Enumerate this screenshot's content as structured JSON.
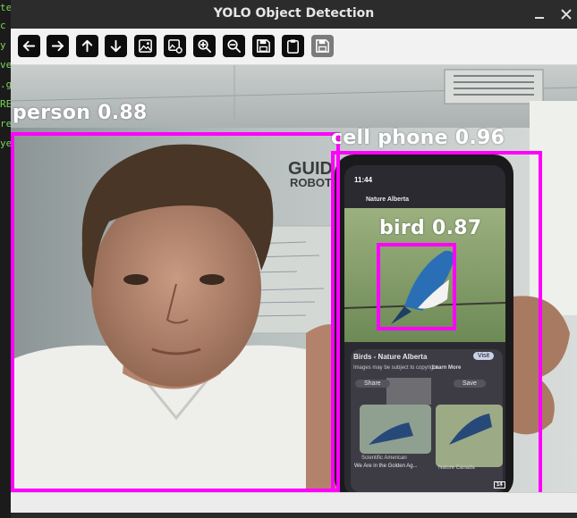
{
  "window": {
    "title": "YOLO Object Detection"
  },
  "terminal_fragments": [
    "te",
    "c",
    "y",
    "ve",
    ".g",
    "RE",
    "re",
    "ye"
  ],
  "toolbar": [
    {
      "name": "back-arrow-icon",
      "tooltip": ""
    },
    {
      "name": "forward-arrow-icon",
      "tooltip": ""
    },
    {
      "name": "up-arrow-icon",
      "tooltip": ""
    },
    {
      "name": "down-arrow-icon",
      "tooltip": ""
    },
    {
      "name": "image-icon",
      "tooltip": ""
    },
    {
      "name": "image-settings-icon",
      "tooltip": ""
    },
    {
      "name": "zoom-in-icon",
      "tooltip": ""
    },
    {
      "name": "zoom-out-icon",
      "tooltip": ""
    },
    {
      "name": "save-icon",
      "tooltip": ""
    },
    {
      "name": "clipboard-icon",
      "tooltip": ""
    },
    {
      "name": "save-disabled-icon",
      "tooltip": ""
    }
  ],
  "detections": [
    {
      "label": "person 0.88",
      "class": "person",
      "confidence": 0.88
    },
    {
      "label": "cell phone 0.96",
      "class": "cell phone",
      "confidence": 0.96
    },
    {
      "label": "bird 0.87",
      "class": "bird",
      "confidence": 0.87
    }
  ],
  "colors": {
    "box": "#ff00ff",
    "label_text": "#ffffff",
    "titlebar": "#2c2c2c"
  },
  "wall_sign": {
    "line1": "GUID",
    "line2": "ROBOT"
  },
  "phone_screen": {
    "time": "11:44",
    "account": "Nature Alberta",
    "post_title": "Birds - Nature Alberta",
    "visit": "Visit",
    "copyright": "Images may be subject to copyright.",
    "learn_more": "Learn More",
    "share": "Share",
    "save": "Save",
    "source1": "Scientific American",
    "caption1": "We Are in the Golden Ag...",
    "source2": "Nature Canada",
    "tabs_count": "14"
  }
}
